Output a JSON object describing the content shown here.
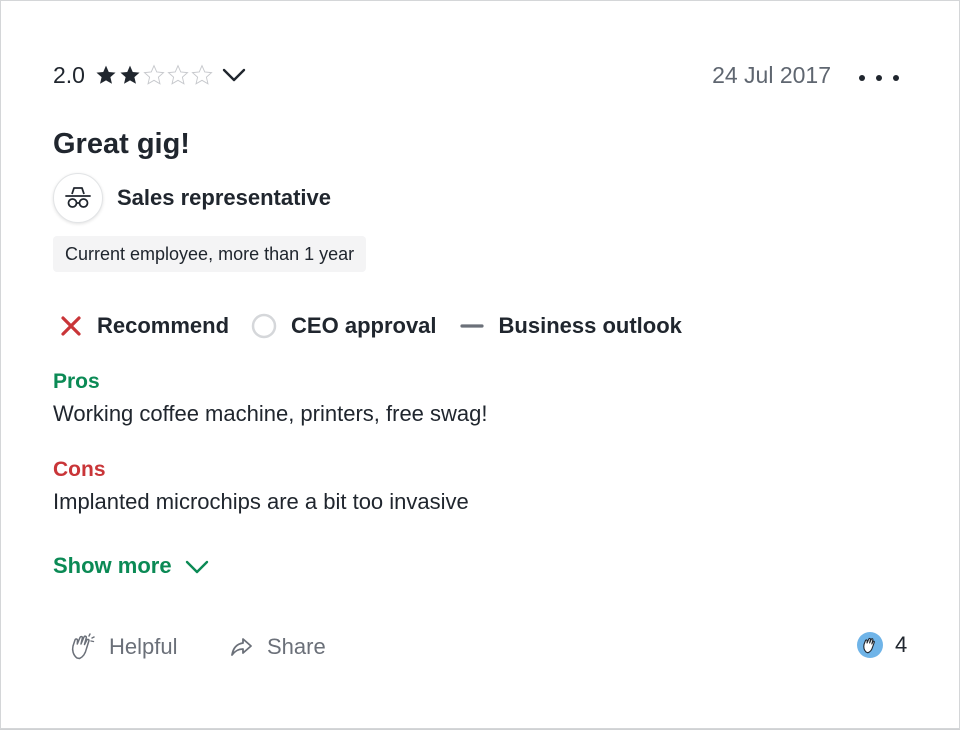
{
  "review": {
    "rating_value": "2.0",
    "rating_stars": 2,
    "rating_max": 5,
    "date": "24 Jul 2017",
    "title": "Great gig!",
    "role": "Sales representative",
    "tenure": "Current employee, more than 1 year",
    "indicators": [
      {
        "label": "Recommend",
        "status": "negative",
        "icon": "x-icon"
      },
      {
        "label": "CEO approval",
        "status": "no-opinion",
        "icon": "circle-icon"
      },
      {
        "label": "Business outlook",
        "status": "neutral",
        "icon": "dash-icon"
      }
    ],
    "pros_label": "Pros",
    "pros_text": "Working coffee machine, printers, free swag!",
    "cons_label": "Cons",
    "cons_text": "Implanted microchips are a bit too invasive",
    "show_more": "Show more",
    "helpful_label": "Helpful",
    "share_label": "Share",
    "reaction_count": "4"
  },
  "colors": {
    "text": "#20262e",
    "muted": "#6b7079",
    "pros": "#0b8a55",
    "cons": "#c93538",
    "star_filled": "#20262e",
    "star_empty": "#c6c8cc"
  }
}
